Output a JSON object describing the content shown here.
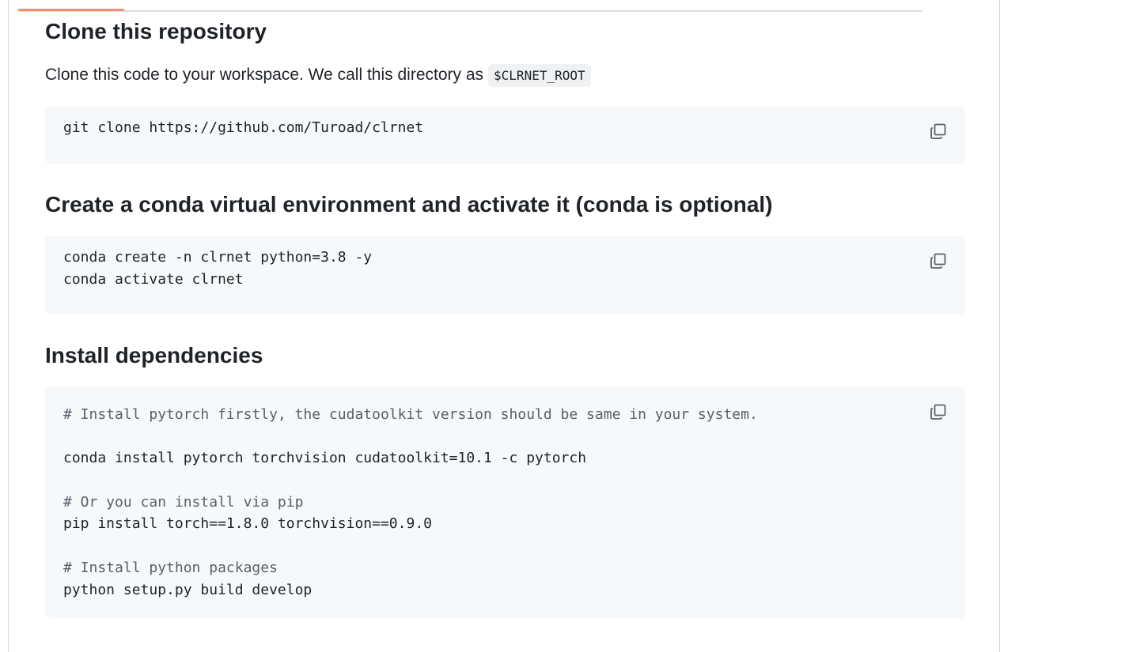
{
  "sections": [
    {
      "heading": "Clone this repository",
      "paragraph": "Clone this code to your workspace. We call this directory as",
      "inline_code": "$CLRNET_ROOT",
      "code": [
        "git clone https://github.com/Turoad/clrnet"
      ]
    },
    {
      "heading": "Create a conda virtual environment and activate it (conda is optional)",
      "code": [
        "conda create -n clrnet python=3.8 -y",
        "conda activate clrnet"
      ]
    },
    {
      "heading": "Install dependencies",
      "code": [
        "# Install pytorch firstly, the cudatoolkit version should be same in your system.",
        "",
        "conda install pytorch torchvision cudatoolkit=10.1 -c pytorch",
        "",
        "# Or you can install via pip",
        "pip install torch==1.8.0 torchvision==0.9.0",
        "",
        "# Install python packages",
        "python setup.py build develop"
      ]
    }
  ],
  "colors": {
    "tab_active": "#fd8c73",
    "code_bg": "#f6f8fa",
    "comment": "#57606a"
  },
  "icons": {
    "copy": "copy-icon"
  }
}
